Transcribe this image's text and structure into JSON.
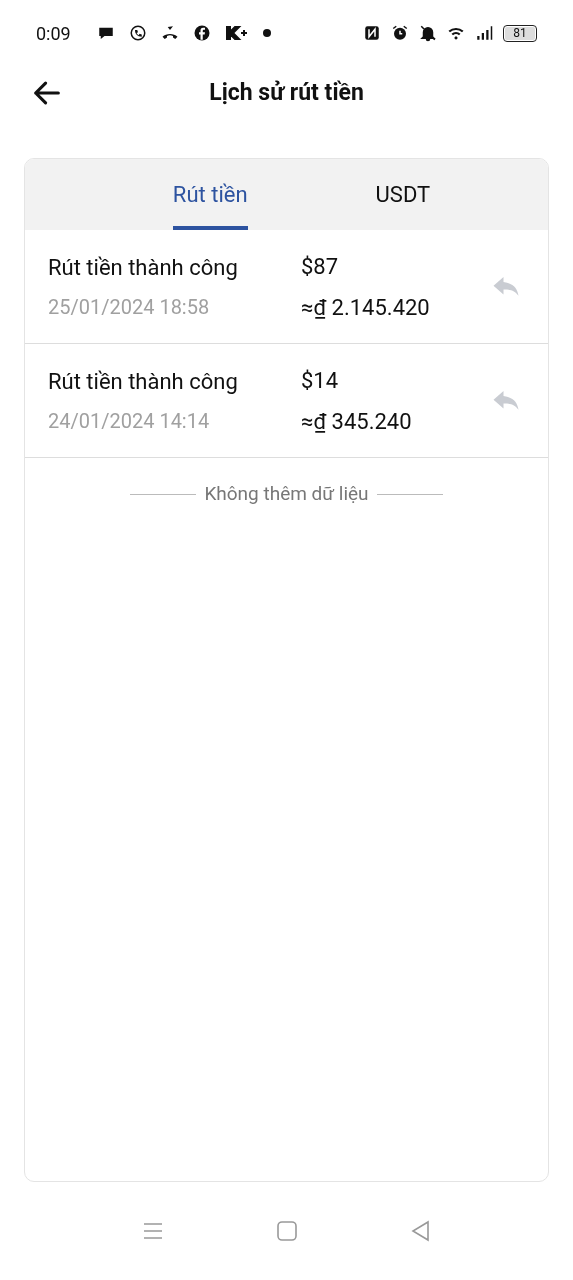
{
  "status_bar": {
    "time": "0:09",
    "battery": "81"
  },
  "header": {
    "title": "Lịch sử rút tiền"
  },
  "tabs": [
    {
      "label": "Rút tiền",
      "selected": true
    },
    {
      "label": "USDT",
      "selected": false
    }
  ],
  "records": [
    {
      "status": "Rút tiền thành công",
      "datetime": "25/01/2024 18:58",
      "amount": "$87",
      "converted": "≈₫ 2.145.420"
    },
    {
      "status": "Rút tiền thành công",
      "datetime": "24/01/2024 14:14",
      "amount": "$14",
      "converted": "≈₫ 345.240"
    }
  ],
  "end_note": "Không thêm dữ liệu"
}
